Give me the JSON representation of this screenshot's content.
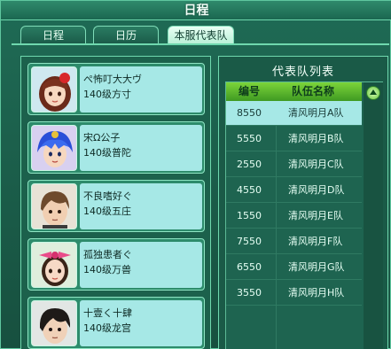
{
  "window": {
    "title": "日程"
  },
  "tabs": [
    {
      "label": "日程",
      "active": false
    },
    {
      "label": "日历",
      "active": false
    },
    {
      "label": "本服代表队",
      "active": true
    }
  ],
  "members": [
    {
      "name": "ぺ怖叮大大ヴ",
      "level_school": "140级方寸",
      "avatar": "girl-red-hair-ornament"
    },
    {
      "name": "宋Ω公子",
      "level_school": "140级普陀",
      "avatar": "boy-blue-hair"
    },
    {
      "name": "不良嗜好ぐ",
      "level_school": "140级五庄",
      "avatar": "boy-brown-hair"
    },
    {
      "name": "孤独患者ぐ",
      "level_school": "140级万兽",
      "avatar": "girl-pink-bow"
    },
    {
      "name": "十壹く十肆",
      "level_school": "140级龙宫",
      "avatar": "boy-black-hair"
    }
  ],
  "team_list": {
    "title": "代表队列表",
    "headers": {
      "id": "编号",
      "name": "队伍名称"
    },
    "rows": [
      {
        "id": "8550",
        "name": "清风明月A队",
        "selected": true
      },
      {
        "id": "5550",
        "name": "清风明月B队",
        "selected": false
      },
      {
        "id": "2550",
        "name": "清风明月C队",
        "selected": false
      },
      {
        "id": "4550",
        "name": "清风明月D队",
        "selected": false
      },
      {
        "id": "1550",
        "name": "清风明月E队",
        "selected": false
      },
      {
        "id": "7550",
        "name": "清风明月F队",
        "selected": false
      },
      {
        "id": "6550",
        "name": "清风明月G队",
        "selected": false
      },
      {
        "id": "3550",
        "name": "清风明月H队",
        "selected": false
      }
    ]
  },
  "colors": {
    "accent": "#6fd8ae",
    "selected_row": "#a6e8e6",
    "header": "#7cd43a"
  }
}
